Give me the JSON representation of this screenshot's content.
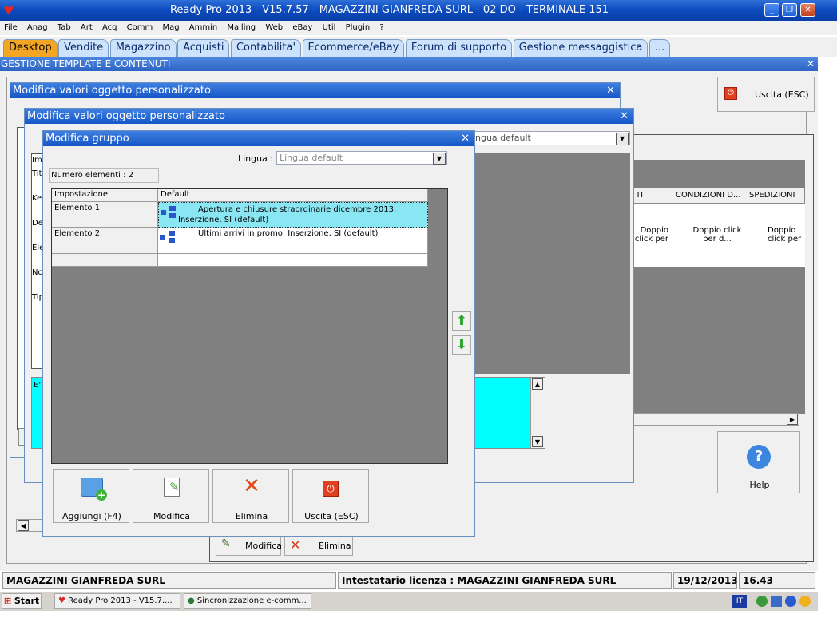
{
  "app": {
    "title": "Ready Pro 2013 - V15.7.57 - MAGAZZINI GIANFREDA SURL - 02 DO - TERMINALE 151",
    "menu": [
      "File",
      "Anag",
      "Tab",
      "Art",
      "Acq",
      "Comm",
      "Mag",
      "Ammin",
      "Mailing",
      "Web",
      "eBay",
      "Util",
      "Plugin",
      "?"
    ],
    "tabs": [
      "Desktop",
      "Vendite",
      "Magazzino",
      "Acquisti",
      "Contabilita'",
      "Ecommerce/eBay",
      "Forum di supporto",
      "Gestione messaggistica",
      "..."
    ],
    "section_title": "GESTIONE TEMPLATE E CONTENUTI",
    "exit_label": "Uscita (ESC)",
    "help_label": "Help"
  },
  "background": {
    "columns": [
      "TI",
      "CONDIZIONI D...",
      "SPEDIZIONI"
    ],
    "cells": [
      "Doppio click per d...",
      "Doppio click per d...",
      "Doppio click per"
    ],
    "letters": [
      "Im",
      "Tit",
      "Ke",
      "De",
      "Ele",
      "No",
      "Tip",
      "E'"
    ],
    "modifica_label": "Modifica",
    "elimina_label": "Elimina",
    "lingua_value": "ngua default"
  },
  "dialog1": {
    "title": "Modifica valori oggetto personalizzato"
  },
  "dialog2": {
    "title": "Modifica valori oggetto personalizzato"
  },
  "dialog3": {
    "title": "Modifica gruppo",
    "lingua_label": "Lingua :",
    "lingua_value": "Lingua default",
    "count_label": "Numero elementi : 2",
    "headers": [
      "Impostazione",
      "Default"
    ],
    "rows": [
      {
        "name": "Elemento 1",
        "value": "Apertura e chiusure straordinarie dicembre 2013, Inserzione, SI (default)"
      },
      {
        "name": "Elemento 2",
        "value": "Ultimi arrivi in promo, Inserzione, SI (default)"
      }
    ],
    "buttons": {
      "add": "Aggiungi (F4)",
      "edit": "Modifica",
      "delete": "Elimina",
      "exit": "Uscita (ESC)"
    }
  },
  "status": {
    "company": "MAGAZZINI GIANFREDA SURL",
    "license": "Intestatario licenza : MAGAZZINI GIANFREDA SURL",
    "date": "19/12/2013",
    "time": "16.43"
  },
  "taskbar": {
    "start": "Start",
    "items": [
      "Ready Pro 2013 - V15.7....",
      "Sincronizzazione e-comm..."
    ],
    "lang": "IT"
  }
}
